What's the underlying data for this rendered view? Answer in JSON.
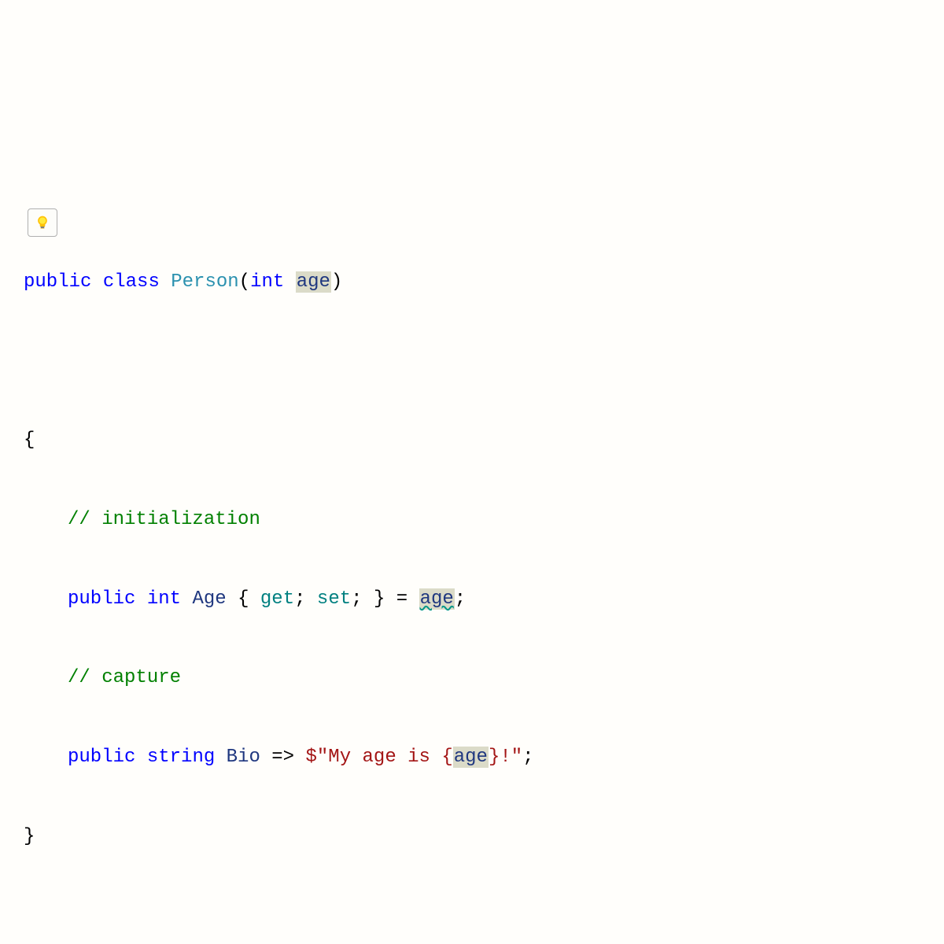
{
  "code": {
    "line1": {
      "public": "public",
      "class": "class",
      "className": "Person",
      "openParen": "(",
      "paramType": "int",
      "paramName": "age",
      "closeParen": ")"
    },
    "line3": {
      "openBrace": "{"
    },
    "line4": {
      "comment": "// initialization"
    },
    "line5": {
      "public": "public",
      "type": "int",
      "member": "Age",
      "openBrace": "{",
      "get": "get",
      "semi1": ";",
      "set": "set",
      "semi2": ";",
      "closeBrace": "}",
      "equals": "=",
      "value": "age",
      "semi3": ";"
    },
    "line6": {
      "comment": "// capture"
    },
    "line7": {
      "public": "public",
      "type": "string",
      "member": "Bio",
      "arrow": "=>",
      "dollar": "$",
      "str1": "\"My age is {",
      "interp": "age",
      "str2": "}!\"",
      "semi": ";"
    },
    "line8": {
      "closeBrace": "}"
    }
  },
  "icons": {
    "lightbulb": "lightbulb-icon"
  }
}
